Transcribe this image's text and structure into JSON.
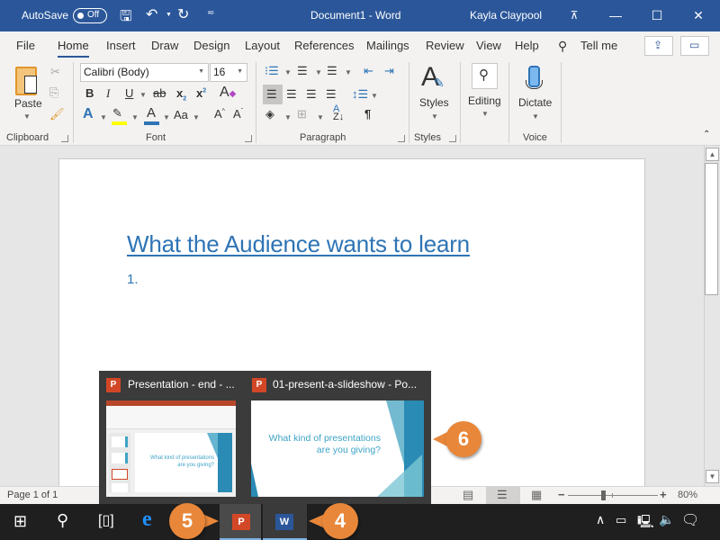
{
  "titlebar": {
    "autosave_label": "AutoSave",
    "autosave_state": "Off",
    "doc_title": "Document1  -  Word",
    "user_name": "Kayla Claypool"
  },
  "tabs": [
    {
      "label": "File"
    },
    {
      "label": "Home"
    },
    {
      "label": "Insert"
    },
    {
      "label": "Draw"
    },
    {
      "label": "Design"
    },
    {
      "label": "Layout"
    },
    {
      "label": "References"
    },
    {
      "label": "Mailings"
    },
    {
      "label": "Review"
    },
    {
      "label": "View"
    },
    {
      "label": "Help"
    }
  ],
  "tell_me": "Tell me",
  "ribbon": {
    "clipboard": {
      "label": "Clipboard",
      "paste": "Paste"
    },
    "font": {
      "label": "Font",
      "font_name": "Calibri (Body)",
      "font_size": "16",
      "change_case": "Aa"
    },
    "paragraph": {
      "label": "Paragraph"
    },
    "styles": {
      "label": "Styles",
      "button": "Styles"
    },
    "editing": {
      "button": "Editing"
    },
    "voice": {
      "label": "Voice",
      "button": "Dictate"
    }
  },
  "document": {
    "heading": "What the Audience wants to learn",
    "list_number": "1."
  },
  "statusbar": {
    "page_info": "Page 1 of 1",
    "zoom_level": "80%",
    "zoom_minus": "−",
    "zoom_plus": "+"
  },
  "thumbnails": [
    {
      "title": "Presentation - end - ...",
      "slide_text_1": "What kind of presentations",
      "slide_text_2": "are you giving?"
    },
    {
      "title": "01-present-a-slideshow - Po...",
      "slide_text_1": "What kind of presentations",
      "slide_text_2": "are you giving?"
    }
  ],
  "callouts": {
    "c4": "4",
    "c5": "5",
    "c6": "6"
  },
  "colors": {
    "word_blue": "#2b579a",
    "heading_blue": "#2e74b5",
    "ppt_red": "#d24726",
    "callout_orange": "#e8873a"
  }
}
